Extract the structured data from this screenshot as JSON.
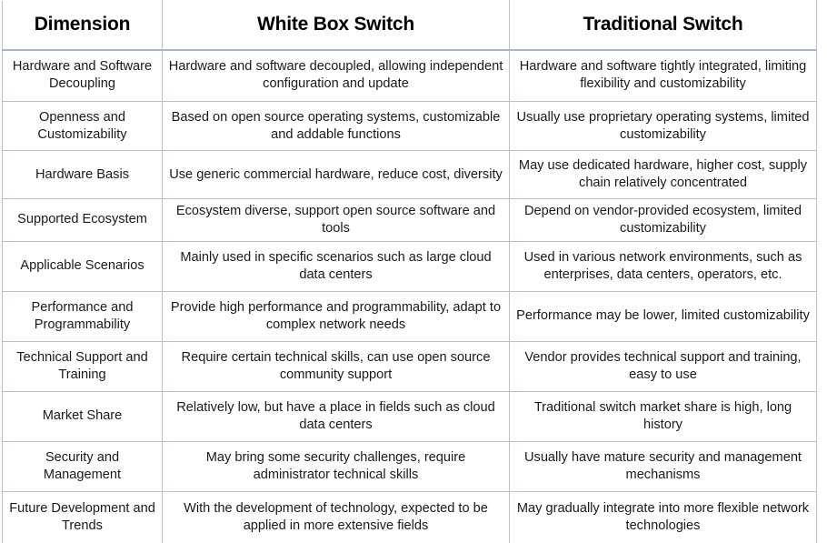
{
  "table": {
    "headers": [
      "Dimension",
      "White Box Switch",
      "Traditional Switch"
    ],
    "rows": [
      {
        "dimension": "Hardware and Software Decoupling",
        "white_box": "Hardware and software decoupled, allowing independent configuration and update",
        "traditional": "Hardware and software tightly integrated, limiting flexibility and customizability"
      },
      {
        "dimension": "Openness and Customizability",
        "white_box": "Based on open source operating systems, customizable and addable functions",
        "traditional": "Usually use proprietary operating systems, limited customizability"
      },
      {
        "dimension": "Hardware Basis",
        "white_box": "Use generic commercial hardware, reduce cost, diversity",
        "traditional": "May use dedicated hardware, higher cost, supply chain relatively concentrated"
      },
      {
        "dimension": "Supported Ecosystem",
        "white_box": "Ecosystem diverse, support open source software and tools",
        "traditional": "Depend on vendor-provided ecosystem, limited customizability"
      },
      {
        "dimension": "Applicable Scenarios",
        "white_box": "Mainly used in specific scenarios such as large cloud data centers",
        "traditional": "Used in various network environments, such as enterprises, data centers, operators, etc."
      },
      {
        "dimension": "Performance and Programmability",
        "white_box": "Provide high performance and programmability, adapt to complex network needs",
        "traditional": "Performance may be lower, limited customizability"
      },
      {
        "dimension": "Technical Support and Training",
        "white_box": "Require certain technical skills, can use open source community support",
        "traditional": "Vendor provides technical support and training, easy to use"
      },
      {
        "dimension": "Market Share",
        "white_box": "Relatively low, but have a place in fields such as cloud data centers",
        "traditional": "Traditional switch market share is high, long history"
      },
      {
        "dimension": "Security and Management",
        "white_box": "May bring some security challenges, require administrator technical skills",
        "traditional": "Usually have mature security and management mechanisms"
      },
      {
        "dimension": "Future Development and Trends",
        "white_box": "With the development of technology, expected to be applied in more extensive fields",
        "traditional": "May gradually integrate into more flexible network technologies"
      }
    ]
  },
  "colors": {
    "border": "#b8c0d0",
    "header_rule": "#aab4c8",
    "text": "#1a1a1a",
    "background": "#ffffff"
  }
}
